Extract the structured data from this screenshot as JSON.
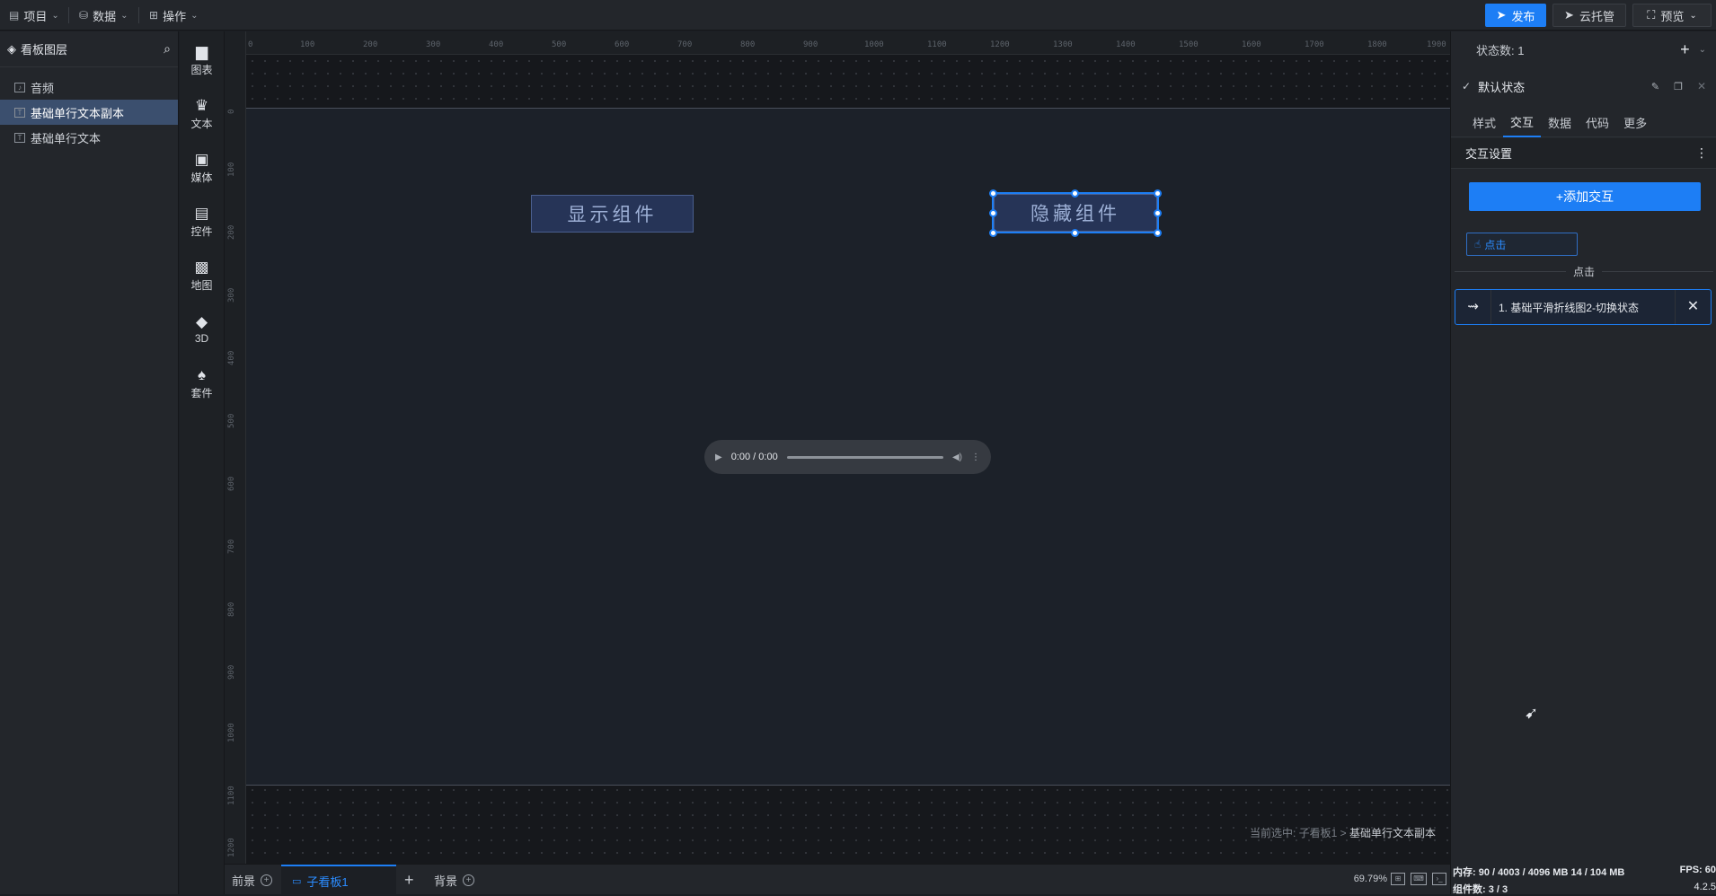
{
  "topbar": {
    "menus": [
      {
        "icon": "file-icon",
        "glyph": "▤",
        "label": "项目"
      },
      {
        "icon": "database-icon",
        "glyph": "⛁",
        "label": "数据"
      },
      {
        "icon": "grid-icon",
        "glyph": "⊞",
        "label": "操作"
      }
    ],
    "publish": "发布",
    "cloud": "云托管",
    "preview": "预览"
  },
  "layers": {
    "title": "看板图层",
    "items": [
      {
        "label": "音频",
        "active": false
      },
      {
        "label": "基础单行文本副本",
        "active": true
      },
      {
        "label": "基础单行文本",
        "active": false
      }
    ]
  },
  "components": [
    {
      "icon": "chart-icon",
      "glyph": "▆",
      "label": "图表"
    },
    {
      "icon": "text-icon",
      "glyph": "♛",
      "label": "文本"
    },
    {
      "icon": "media-icon",
      "glyph": "▣",
      "label": "媒体"
    },
    {
      "icon": "control-icon",
      "glyph": "▤",
      "label": "控件"
    },
    {
      "icon": "map-icon",
      "glyph": "▩",
      "label": "地图"
    },
    {
      "icon": "cube-icon",
      "glyph": "◆",
      "label": "3D"
    },
    {
      "icon": "shirt-icon",
      "glyph": "♠",
      "label": "套件"
    }
  ],
  "ruler": {
    "top": [
      "0",
      "100",
      "200",
      "300",
      "400",
      "500",
      "600",
      "700",
      "800",
      "900",
      "1000",
      "1100",
      "1200",
      "1300",
      "1400",
      "1500",
      "1600",
      "1700",
      "1800",
      "1900"
    ],
    "left": [
      "0",
      "100",
      "200",
      "300",
      "400",
      "500",
      "600",
      "700",
      "800",
      "900",
      "1000",
      "1100",
      "1200"
    ]
  },
  "canvas": {
    "show_button": "显示组件",
    "hide_button": "隐藏组件",
    "audio_time": "0:00 / 0:00",
    "breadcrumb_prefix": "当前选中: 子看板1 > ",
    "breadcrumb_current": "基础单行文本副本"
  },
  "bottom": {
    "tabs": [
      "前景",
      "子看板1",
      "背景"
    ],
    "zoom": "69.79%"
  },
  "right": {
    "state_count_label": "状态数: 1",
    "default_state": "默认状态",
    "tabs": [
      "样式",
      "交互",
      "数据",
      "代码",
      "更多"
    ],
    "active_tab": "交互",
    "section_title": "交互设置",
    "add_button": "+添加交互",
    "trigger": "点击",
    "divider": "点击",
    "action": "1. 基础平滑折线图2-切换状态",
    "memory": "内存: 90 / 4003 / 4096 MB  14 / 104 MB",
    "fps": "FPS: 60",
    "components_count": "组件数: 3 / 3",
    "version": "4.2.5"
  },
  "colors": {
    "accent": "#1d7ef5",
    "board_bg": "#1c2129",
    "button_bg": "#263457"
  }
}
